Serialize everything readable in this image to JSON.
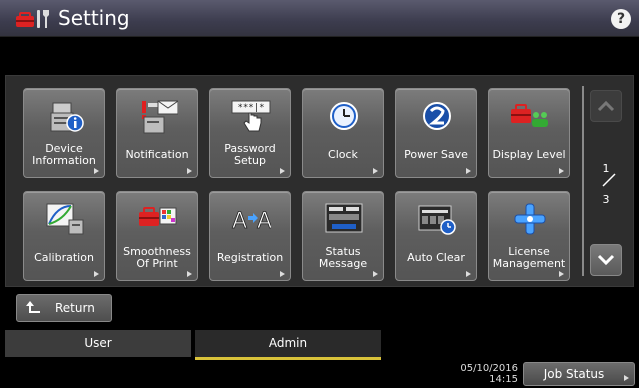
{
  "header": {
    "title": "Setting",
    "help_label": "?"
  },
  "tiles": [
    {
      "label": "Device Information",
      "icon": "device-information-icon"
    },
    {
      "label": "Notification",
      "icon": "notification-icon"
    },
    {
      "label": "Password Setup",
      "icon": "password-setup-icon"
    },
    {
      "label": "Clock",
      "icon": "clock-icon"
    },
    {
      "label": "Power Save",
      "icon": "power-save-icon"
    },
    {
      "label": "Display Level",
      "icon": "display-level-icon"
    },
    {
      "label": "Calibration",
      "icon": "calibration-icon"
    },
    {
      "label": "Smoothness Of Print",
      "icon": "smoothness-icon"
    },
    {
      "label": "Registration",
      "icon": "registration-icon"
    },
    {
      "label": "Status Message",
      "icon": "status-message-icon"
    },
    {
      "label": "Auto Clear",
      "icon": "auto-clear-icon"
    },
    {
      "label": "License Management",
      "icon": "license-management-icon"
    }
  ],
  "pager": {
    "current": "1",
    "total": "3"
  },
  "return_label": "Return",
  "tabs": [
    {
      "label": "User",
      "active": false
    },
    {
      "label": "Admin",
      "active": true
    }
  ],
  "status": {
    "date": "05/10/2016",
    "time": "14:15",
    "job_status_label": "Job Status"
  },
  "colors": {
    "active_tab_underline": "#d9c23a",
    "notification_alert": "#e02020",
    "power_save_blue": "#1a4fa8"
  }
}
